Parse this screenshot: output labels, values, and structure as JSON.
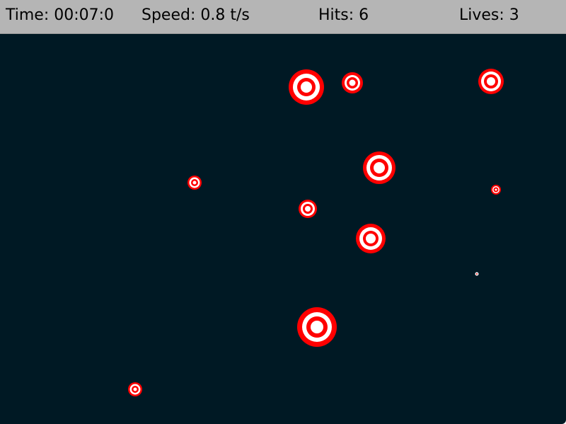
{
  "hud": {
    "time": "Time: 00:07:0",
    "speed": "Speed: 0.8 t/s",
    "hits": "Hits: 6",
    "lives": "Lives: 3"
  },
  "colors": {
    "hud_bg": "#b5b5b5",
    "playfield_bg": "#001924",
    "target_red": "#ff0000",
    "target_white": "#ffffff"
  },
  "targets_count": 11
}
